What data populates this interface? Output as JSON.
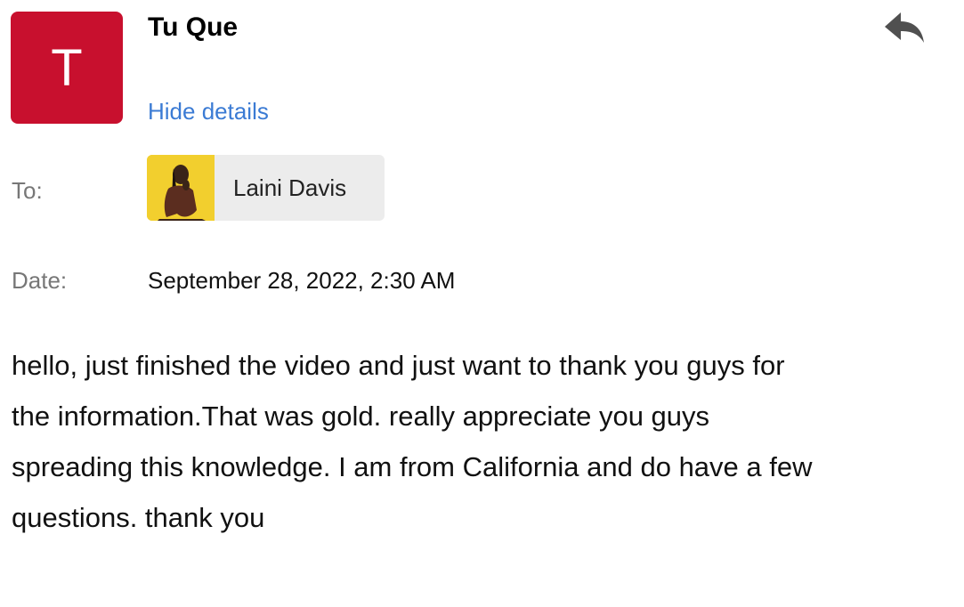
{
  "sender": {
    "avatar_letter": "T",
    "avatar_color": "#c8102e",
    "name": "Tu Que"
  },
  "actions": {
    "reply_icon": "reply-icon",
    "hide_details_label": "Hide details"
  },
  "recipients": {
    "label": "To:",
    "items": [
      {
        "name": "Laini Davis",
        "photo": "recipient-photo"
      }
    ]
  },
  "date": {
    "label": "Date:",
    "value": "September 28, 2022, 2:30 AM"
  },
  "message": {
    "lines": [
      "hello, just finished the video and just want to thank you guys for",
      "the information.That was gold. really appreciate you guys",
      "spreading this knowledge. I am from California and do have a few",
      "questions. thank you"
    ]
  },
  "colors": {
    "link": "#3b7bd4",
    "chip_background": "#ececec",
    "photo_background": "#f2cf2e"
  }
}
